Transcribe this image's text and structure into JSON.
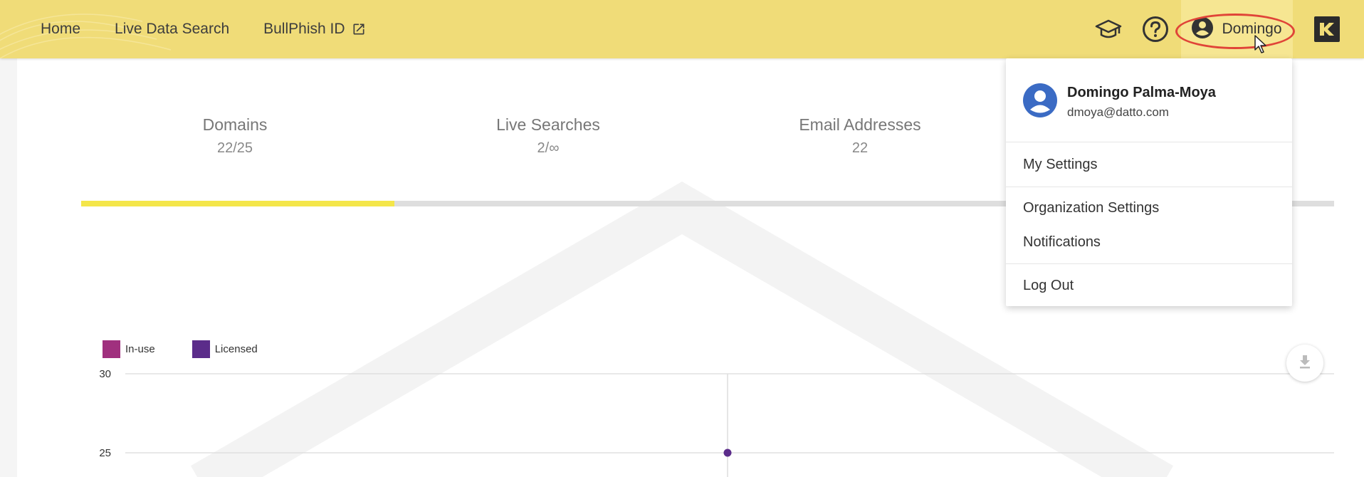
{
  "nav": {
    "home": "Home",
    "live_data_search": "Live Data Search",
    "bullphish_id": "BullPhish ID"
  },
  "header": {
    "user_name": "Domingo",
    "icons": [
      "graduation-cap-icon",
      "help-circle-icon",
      "account-circle-icon",
      "brand-logo-icon"
    ]
  },
  "stats": [
    {
      "label": "Domains",
      "value": "22/25",
      "active": true
    },
    {
      "label": "Live Searches",
      "value": "2/∞",
      "active": false
    },
    {
      "label": "Email Addresses",
      "value": "22",
      "active": false
    }
  ],
  "progress": {
    "fraction": 0.25
  },
  "user_menu": {
    "full_name": "Domingo Palma-Moya",
    "email": "dmoya@datto.com",
    "items": [
      "My Settings",
      "Organization Settings",
      "Notifications",
      "Log Out"
    ]
  },
  "colors": {
    "topbar": "#f0dc78",
    "accent_yellow": "#f4e64a",
    "in_use": "#a0307e",
    "licensed": "#5b2c8a",
    "highlight_ring": "#e04438"
  },
  "chart_data": {
    "type": "scatter",
    "legend": [
      {
        "name": "In-use",
        "color": "#a0307e"
      },
      {
        "name": "Licensed",
        "color": "#5b2c8a"
      }
    ],
    "y_ticks": [
      30,
      25
    ],
    "series": [
      {
        "name": "Licensed",
        "values": [
          25
        ]
      }
    ],
    "legend_position": "top-left",
    "grid": true
  }
}
